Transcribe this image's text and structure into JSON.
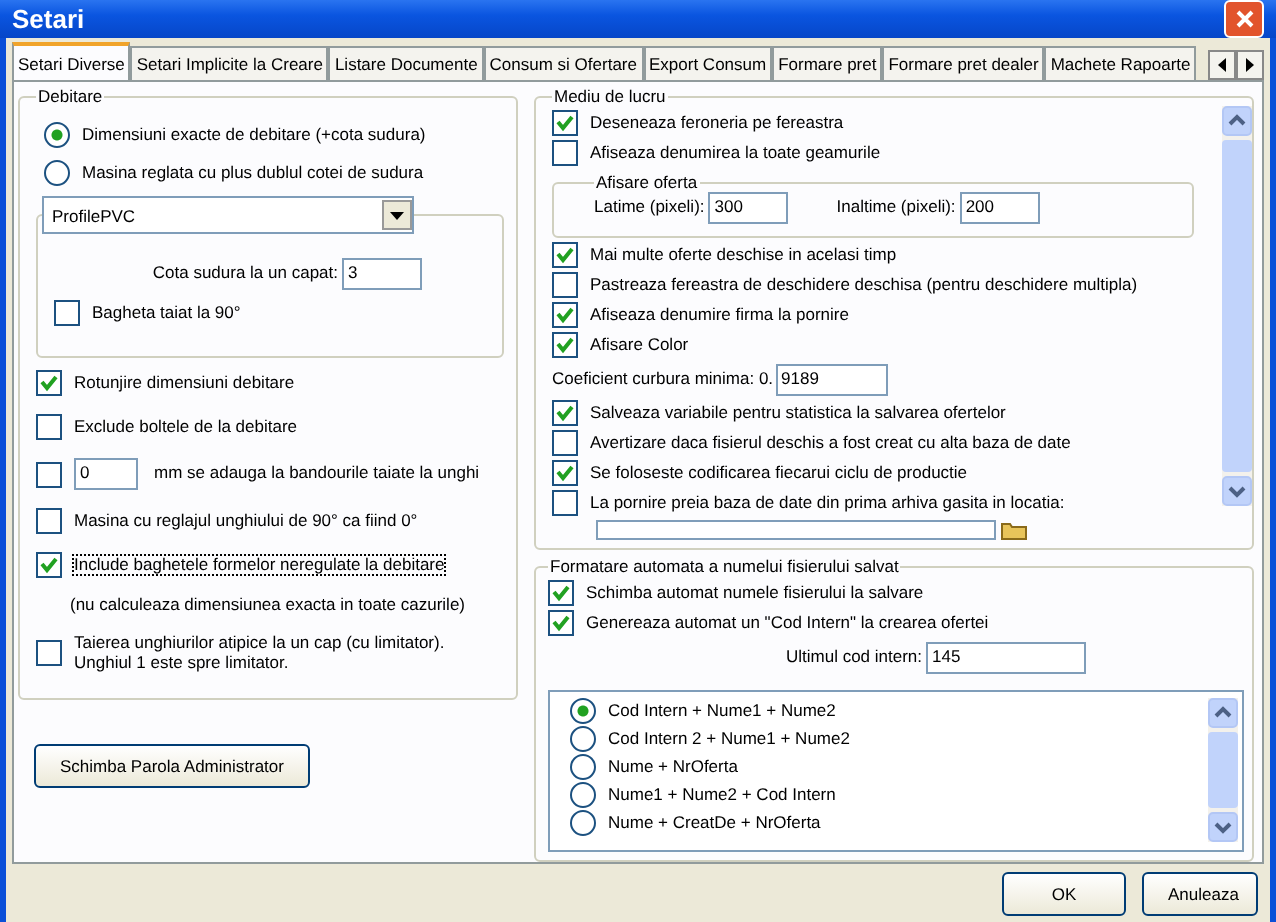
{
  "window": {
    "title": "Setari"
  },
  "tabs": [
    {
      "label": "Setari Diverse",
      "selected": true
    },
    {
      "label": "Setari Implicite la Creare",
      "selected": false
    },
    {
      "label": "Listare Documente",
      "selected": false
    },
    {
      "label": "Consum si Ofertare",
      "selected": false
    },
    {
      "label": "Export Consum",
      "selected": false
    },
    {
      "label": "Formare pret",
      "selected": false
    },
    {
      "label": "Formare pret dealer",
      "selected": false
    },
    {
      "label": "Machete Rapoarte",
      "selected": false
    }
  ],
  "debitare": {
    "title": "Debitare",
    "radios": [
      {
        "label": "Dimensiuni exacte de debitare (+cota sudura)",
        "selected": true
      },
      {
        "label": "Masina reglata cu plus dublul cotei de sudura",
        "selected": false
      }
    ],
    "profile": {
      "value": "ProfilePVC",
      "cota_label": "Cota sudura la un capat:",
      "cota_value": "3",
      "bagheta": {
        "label": "Bagheta taiat la 90°",
        "checked": false
      }
    },
    "options": [
      {
        "kind": "checkbox",
        "label": "Rotunjire dimensiuni debitare",
        "checked": true
      },
      {
        "kind": "checkbox",
        "label": "Exclude boltele de la debitare",
        "checked": false
      },
      {
        "kind": "checkbox_input",
        "checked": false,
        "field": {
          "value": "0",
          "suffix": "mm se adauga la bandourile taiate la unghi"
        }
      },
      {
        "kind": "checkbox",
        "label": "Masina cu reglajul unghiului  de 90° ca fiind 0°",
        "checked": false
      },
      {
        "kind": "checkbox",
        "label": "Include baghetele formelor neregulate la debitare",
        "checked": true,
        "focused": true
      },
      {
        "kind": "note",
        "label": "(nu calculeaza dimensiunea exacta in toate cazurile)"
      },
      {
        "kind": "checkbox",
        "label": "Taierea unghiurilor atipice la un cap (cu limitator). Unghiul 1 este spre limitator.",
        "checked": false
      }
    ]
  },
  "admin_button": "Schimba Parola Administrator",
  "mediu": {
    "title": "Mediu de lucru",
    "items": [
      {
        "kind": "checkbox",
        "label": "Deseneaza feroneria pe fereastra",
        "checked": true
      },
      {
        "kind": "checkbox",
        "label": "Afiseaza denumirea la toate geamurile",
        "checked": false
      },
      {
        "kind": "group",
        "title": "Afisare oferta",
        "fields": [
          {
            "label": "Latime (pixeli):",
            "value": "300"
          },
          {
            "label": "Inaltime (pixeli):",
            "value": "200"
          }
        ]
      },
      {
        "kind": "checkbox",
        "label": "Mai multe oferte deschise in acelasi timp",
        "checked": true
      },
      {
        "kind": "checkbox",
        "label": "Pastreaza fereastra de deschidere deschisa (pentru deschidere multipla)",
        "checked": false
      },
      {
        "kind": "checkbox",
        "label": "Afiseaza denumire firma la pornire",
        "checked": true
      },
      {
        "kind": "checkbox",
        "label": "Afisare Color",
        "checked": true
      },
      {
        "kind": "field",
        "label": "Coeficient curbura minima: 0.",
        "value": "9189"
      },
      {
        "kind": "checkbox",
        "label": "Salveaza variabile pentru statistica la salvarea ofertelor",
        "checked": true
      },
      {
        "kind": "checkbox",
        "label": "Avertizare daca fisierul deschis a fost creat cu alta baza de date",
        "checked": false
      },
      {
        "kind": "checkbox",
        "label": "Se foloseste codificarea fiecarui ciclu de productie",
        "checked": true
      },
      {
        "kind": "checkbox_path",
        "label": "La pornire preia baza de date din prima arhiva gasita in locatia:",
        "checked": false
      }
    ]
  },
  "formatare": {
    "title": "Formatare automata a numelui fisierului salvat",
    "checkboxes": [
      {
        "label": "Schimba automat numele fisierului la salvare",
        "checked": true
      },
      {
        "label": "Genereaza automat un \"Cod Intern\" la crearea ofertei",
        "checked": true
      }
    ],
    "last_code": {
      "label": "Ultimul cod intern:",
      "value": "145"
    },
    "formats": [
      {
        "label": "Cod Intern + Nume1 + Nume2",
        "selected": true
      },
      {
        "label": "Cod Intern 2 + Nume1 + Nume2",
        "selected": false
      },
      {
        "label": "Nume + NrOferta",
        "selected": false
      },
      {
        "label": "Nume1 + Nume2 + Cod Intern",
        "selected": false
      },
      {
        "label": "Nume + CreatDe + NrOferta",
        "selected": false
      }
    ]
  },
  "buttons": [
    "OK",
    "Anuleaza"
  ]
}
